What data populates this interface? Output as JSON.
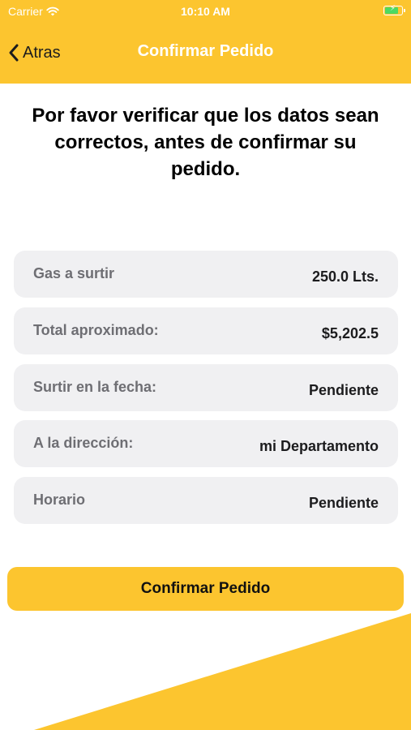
{
  "status_bar": {
    "carrier": "Carrier",
    "time": "10:10 AM"
  },
  "nav": {
    "back_label": "Atras",
    "title": "Confirmar Pedido"
  },
  "intro_text": "Por favor verificar que los datos sean correctos, antes de confirmar su pedido.",
  "summary": [
    {
      "label": "Gas a surtir",
      "value": "250.0 Lts."
    },
    {
      "label": "Total aproximado:",
      "value": "$5,202.5"
    },
    {
      "label": "Surtir en la fecha:",
      "value": "Pendiente"
    },
    {
      "label": "A la dirección:",
      "value": "mi Departamento"
    },
    {
      "label": "Horario",
      "value": "Pendiente"
    }
  ],
  "confirm_button_label": "Confirmar Pedido",
  "colors": {
    "accent": "#fcc52f",
    "row_background": "#f0f0f2",
    "label": "#6e6e73"
  }
}
